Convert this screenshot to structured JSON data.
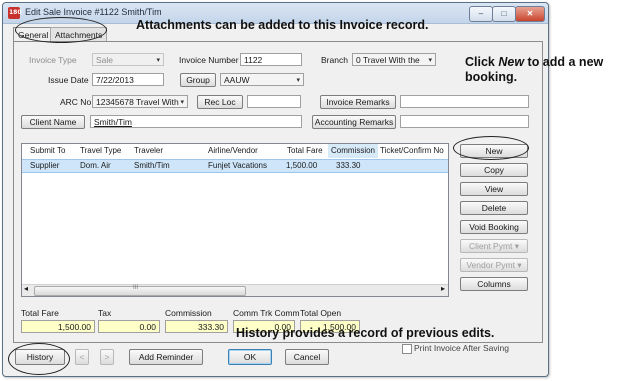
{
  "window": {
    "title": "Edit Sale Invoice #1122 Smith/Tim",
    "app_icon_text": "180",
    "controls": {
      "minimize": "–",
      "maximize": "□",
      "close": "✕"
    }
  },
  "tabs": [
    {
      "label": "General"
    },
    {
      "label": "Attachments"
    }
  ],
  "form": {
    "invoice_type_label": "Invoice Type",
    "invoice_type_value": "Sale",
    "invoice_number_label": "Invoice Number",
    "invoice_number_value": "1122",
    "branch_label": "Branch",
    "branch_value": "0 Travel With the",
    "issue_date_label": "Issue Date",
    "issue_date_value": "7/22/2013",
    "group_button": "Group",
    "group_value": "AAUW",
    "arc_no_label": "ARC No",
    "arc_no_value": "12345678 Travel With",
    "rec_loc_button": "Rec Loc",
    "rec_loc_value": "",
    "invoice_remarks_button": "Invoice Remarks",
    "invoice_remarks_value": "",
    "client_name_button": "Client Name",
    "client_name_value": "Smith/Tim",
    "accounting_remarks_button": "Accounting Remarks",
    "accounting_remarks_value": ""
  },
  "grid": {
    "columns": [
      "Submit To",
      "Travel Type",
      "Traveler",
      "Airline/Vendor",
      "Total Fare",
      "Commission",
      "Ticket/Confirm No"
    ],
    "rows": [
      [
        "Supplier",
        "Dom. Air",
        "Smith/Tim",
        "Funjet Vacations",
        "1,500.00",
        "333.30",
        ""
      ]
    ],
    "scroll_left": "◂",
    "scroll_right": "▸",
    "scroll_grip": "III"
  },
  "side_buttons": {
    "new": "New",
    "copy": "Copy",
    "view": "View",
    "delete": "Delete",
    "void_booking": "Void Booking",
    "client_pymt": "Client Pymt",
    "vendor_pymt": "Vendor Pymt",
    "columns": "Columns",
    "dropdown_arrow": "▾"
  },
  "totals": {
    "total_fare_label": "Total Fare",
    "total_fare_value": "1,500.00",
    "tax_label": "Tax",
    "tax_value": "0.00",
    "commission_label": "Commission",
    "commission_value": "333.30",
    "comm_trk_label": "Comm Trk Comm",
    "comm_trk_value": "0.00",
    "total_open_label": "Total Open",
    "total_open_value": "1,500.00"
  },
  "footer": {
    "history_button": "History",
    "prev_button": "<",
    "next_button": ">",
    "add_reminder_button": "Add Reminder",
    "ok_button": "OK",
    "cancel_button": "Cancel",
    "print_checkbox_label": "Print Invoice After Saving",
    "print_checked": false
  },
  "annotations": {
    "attachments_note": "Attachments can be added to this Invoice record.",
    "new_note_prefix": "Click ",
    "new_note_em": "New",
    "new_note_suffix": " to add a new",
    "new_note_line2": "booking.",
    "history_note": "History provides a record of previous edits."
  },
  "colors": {
    "selected_row": "#cfe6fa",
    "totals_field": "#ffffc8",
    "ok_button_border": "#3c7fb1",
    "window_border": "#5b6f86"
  }
}
